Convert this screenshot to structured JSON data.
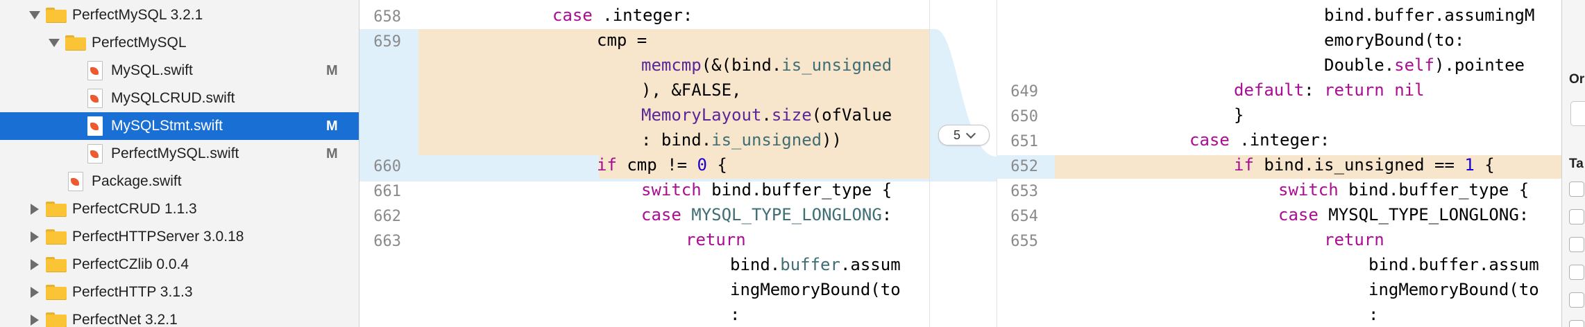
{
  "navigator": {
    "items": [
      {
        "label": "PerfectMySQL 3.2.1",
        "badge": "",
        "kind": "folder",
        "expanded": true,
        "selected": false
      },
      {
        "label": "PerfectMySQL",
        "badge": "",
        "kind": "folder",
        "expanded": true,
        "selected": false
      },
      {
        "label": "MySQL.swift",
        "badge": "M",
        "kind": "swift-file",
        "expanded": false,
        "selected": false
      },
      {
        "label": "MySQLCRUD.swift",
        "badge": "",
        "kind": "swift-file",
        "expanded": false,
        "selected": false
      },
      {
        "label": "MySQLStmt.swift",
        "badge": "M",
        "kind": "swift-file",
        "expanded": false,
        "selected": true
      },
      {
        "label": "PerfectMySQL.swift",
        "badge": "M",
        "kind": "swift-file",
        "expanded": false,
        "selected": false
      },
      {
        "label": "Package.swift",
        "badge": "",
        "kind": "swift-file",
        "expanded": false,
        "selected": false
      },
      {
        "label": "PerfectCRUD 1.1.3",
        "badge": "",
        "kind": "folder",
        "expanded": false,
        "selected": false
      },
      {
        "label": "PerfectHTTPServer 3.0.18",
        "badge": "",
        "kind": "folder",
        "expanded": false,
        "selected": false
      },
      {
        "label": "PerfectCZlib 0.0.4",
        "badge": "",
        "kind": "folder",
        "expanded": false,
        "selected": false
      },
      {
        "label": "PerfectHTTP 3.1.3",
        "badge": "",
        "kind": "folder",
        "expanded": false,
        "selected": false
      },
      {
        "label": "PerfectNet 3.2.1",
        "badge": "",
        "kind": "folder",
        "expanded": false,
        "selected": false
      }
    ]
  },
  "diff": {
    "change_count": "5",
    "left": {
      "line_numbers": [
        "658",
        "659",
        "660",
        "661",
        "662",
        "663"
      ],
      "lines": [
        [
          {
            "t": "case",
            "c": "kw"
          },
          {
            "t": " .integer:"
          }
        ],
        [
          {
            "t": "cmp ="
          }
        ],
        [
          {
            "t": "memcmp",
            "c": "fn"
          },
          {
            "t": "(&(bind."
          },
          {
            "t": "is_unsigned",
            "c": "ty"
          }
        ],
        [
          {
            "t": "), &FALSE,"
          }
        ],
        [
          {
            "t": "MemoryLayout",
            "c": "fn"
          },
          {
            "t": "."
          },
          {
            "t": "size",
            "c": "fn"
          },
          {
            "t": "(ofValue"
          }
        ],
        [
          {
            "t": ": bind."
          },
          {
            "t": "is_unsigned",
            "c": "ty"
          },
          {
            "t": "))"
          }
        ],
        [
          {
            "t": "if",
            "c": "kw"
          },
          {
            "t": " cmp != "
          },
          {
            "t": "0",
            "c": "nm"
          },
          {
            "t": " {"
          }
        ],
        [
          {
            "t": "switch",
            "c": "kw"
          },
          {
            "t": " bind.buffer_type {"
          }
        ],
        [
          {
            "t": "case",
            "c": "kw"
          },
          {
            "t": " "
          },
          {
            "t": "MYSQL_TYPE_LONGLONG",
            "c": "ty"
          },
          {
            "t": ":"
          }
        ],
        [
          {
            "t": "return",
            "c": "kw"
          }
        ],
        [
          {
            "t": "bind."
          },
          {
            "t": "buffer",
            "c": "ty"
          },
          {
            "t": ".assum"
          }
        ],
        [
          {
            "t": "ingMemoryBound(to"
          }
        ],
        [
          {
            "t": ":"
          }
        ]
      ]
    },
    "right": {
      "line_numbers": [
        "649",
        "650",
        "651",
        "652",
        "653",
        "654",
        "655"
      ],
      "lines": [
        [
          {
            "t": "bind.buffer.assumingM"
          }
        ],
        [
          {
            "t": "emoryBound(to:"
          }
        ],
        [
          {
            "t": "Double."
          },
          {
            "t": "self",
            "c": "kw"
          },
          {
            "t": ").pointee"
          }
        ],
        [
          {
            "t": "default",
            "c": "kw"
          },
          {
            "t": ": "
          },
          {
            "t": "return",
            "c": "kw"
          },
          {
            "t": " "
          },
          {
            "t": "nil",
            "c": "kw"
          }
        ],
        [
          {
            "t": "}"
          }
        ],
        [
          {
            "t": "case",
            "c": "kw"
          },
          {
            "t": " .integer:"
          }
        ],
        [
          {
            "t": "if",
            "c": "kw"
          },
          {
            "t": " bind.is_unsigned == "
          },
          {
            "t": "1",
            "c": "nm"
          },
          {
            "t": " {"
          }
        ],
        [
          {
            "t": "switch",
            "c": "kw"
          },
          {
            "t": " bind.buffer_type {"
          }
        ],
        [
          {
            "t": "case",
            "c": "kw"
          },
          {
            "t": " MYSQL_TYPE_LONGLONG:"
          }
        ],
        [
          {
            "t": "return",
            "c": "kw"
          }
        ],
        [
          {
            "t": "bind.buffer.assum"
          }
        ],
        [
          {
            "t": "ingMemoryBound(to"
          }
        ],
        [
          {
            "t": ":"
          }
        ]
      ]
    }
  },
  "inspector": {
    "header_1": "Or",
    "header_2": "Ta"
  },
  "colors": {
    "selection": "#1a6fd5",
    "keyword": "#aa0d91",
    "type": "#3f6e74",
    "function": "#5c2699",
    "number": "#1c00cf",
    "change_band": "#dff0fb",
    "change_highlight": "#f7e6cc"
  }
}
